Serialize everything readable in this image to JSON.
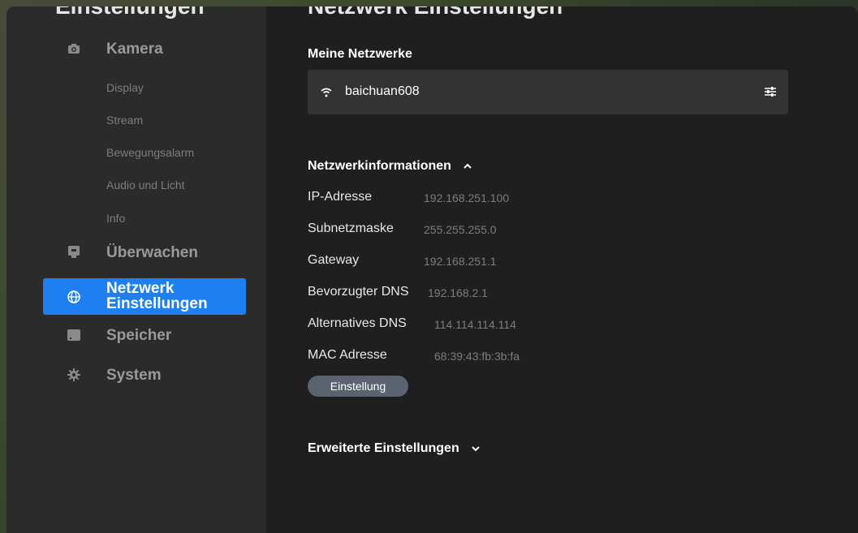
{
  "sidebar": {
    "cut_title": "Einstellungen",
    "items": [
      {
        "label": "Kamera",
        "icon": "camera-icon"
      },
      {
        "label": "Überwachen",
        "icon": "monitor-icon"
      },
      {
        "label": "Netzwerk Einstellungen",
        "label_line1": "Netzwerk",
        "label_line2": "Einstellungen",
        "icon": "globe-icon",
        "active": true
      },
      {
        "label": "Speicher",
        "icon": "storage-icon"
      },
      {
        "label": "System",
        "icon": "gear-icon"
      }
    ],
    "sub_items": [
      "Display",
      "Stream",
      "Bewegungsalarm",
      "Audio und Licht",
      "Info"
    ]
  },
  "main": {
    "page_title": "Netzwerk Einstellungen",
    "my_networks_title": "Meine Netzwerke",
    "network_name": "baichuan608",
    "network_info_title": "Netzwerkinformationen",
    "info": [
      {
        "label": "IP-Adresse",
        "value": "192.168.251.100"
      },
      {
        "label": "Subnetzmaske",
        "value": "255.255.255.0"
      },
      {
        "label": "Gateway",
        "value": "192.168.251.1"
      },
      {
        "label": "Bevorzugter DNS",
        "value": "192.168.2.1"
      },
      {
        "label": "Alternatives DNS",
        "value": "114.114.114.114"
      },
      {
        "label": "MAC Adresse",
        "value": "68:39:43:fb:3b:fa"
      }
    ],
    "settings_button": "Einstellung",
    "advanced_title": "Erweiterte Einstellungen"
  },
  "colors": {
    "accent": "#1e7ff0",
    "sidebar_bg": "#2b2b2b",
    "content_bg": "#1f1f1f",
    "button_bg": "#5b6270"
  }
}
